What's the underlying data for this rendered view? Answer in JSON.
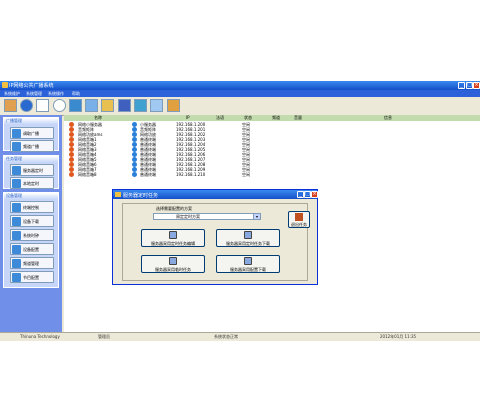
{
  "window": {
    "title": "IP网络公共广播系统",
    "menu": [
      "系统维护",
      "系统管理",
      "系统操作",
      "帮助"
    ]
  },
  "toolbar_icons": [
    "users-icon",
    "record-icon",
    "settings-icon",
    "clock-icon",
    "media-icon",
    "network-icon",
    "folder-icon",
    "monitor-icon",
    "broadcast-icon",
    "snowflake-icon",
    "exit-icon"
  ],
  "sidebar": {
    "groups": [
      {
        "title": "广播管理",
        "buttons": [
          "调取广播",
          "频道广播"
        ]
      },
      {
        "title": "任务管理",
        "buttons": [
          "服务器定时",
          "本地定时"
        ]
      },
      {
        "title": "设备管理",
        "buttons": [
          "终端控制",
          "设备下载",
          "系统时钟",
          "设备配置",
          "频道管理",
          "节目配置"
        ]
      }
    ]
  },
  "list": {
    "columns": [
      "名称",
      "IP",
      "法语",
      "状态",
      "频道",
      "音量",
      "信息"
    ],
    "rows": [
      {
        "name": "网络小服务器",
        "type": "小服务器",
        "ip": "192.168.1.200",
        "status": "空闲"
      },
      {
        "name": "音频矩阵",
        "type": "音频矩阵",
        "ip": "192.168.1.201",
        "status": "空闲"
      },
      {
        "name": "网络功放ams",
        "type": "网络功放",
        "ip": "192.168.1.202",
        "status": "空闲"
      },
      {
        "name": "网络音箱1",
        "type": "普通终端",
        "ip": "192.168.1.203",
        "status": "空闲"
      },
      {
        "name": "网络音箱2",
        "type": "普通终端",
        "ip": "192.168.1.204",
        "status": "空闲"
      },
      {
        "name": "网络音箱3",
        "type": "普通终端",
        "ip": "192.168.1.205",
        "status": "空闲"
      },
      {
        "name": "网络音箱4",
        "type": "普通终端",
        "ip": "192.168.1.206",
        "status": "空闲"
      },
      {
        "name": "网络音箱5",
        "type": "普通终端",
        "ip": "192.168.1.207",
        "status": "空闲"
      },
      {
        "name": "网络音箱6",
        "type": "普通终端",
        "ip": "192.168.1.208",
        "status": "空闲"
      },
      {
        "name": "网络音箱7",
        "type": "普通终端",
        "ip": "192.168.1.209",
        "status": "空闲"
      },
      {
        "name": "网络音箱8",
        "type": "普通终端",
        "ip": "192.168.1.210",
        "status": "空闲"
      }
    ]
  },
  "statusbar": {
    "left": "Thinuna Technology",
    "mid1": "管理员",
    "mid2": "系统状态正常",
    "right": "2012年01月 11:35"
  },
  "dialog": {
    "title": "服务器定时任务",
    "select_label": "选择需要配置的方案",
    "selected_value": "周定定时方案",
    "exit_label": "退出任务",
    "buttons": [
      "服务器采用定时任务编辑",
      "服务器采用定时任务下载",
      "服务器采用临时任务",
      "服务器采用配置下载"
    ]
  },
  "colors": {
    "accent": "#1450c8",
    "sidebar": "#6f8fe8",
    "header": "#c2dcae"
  }
}
